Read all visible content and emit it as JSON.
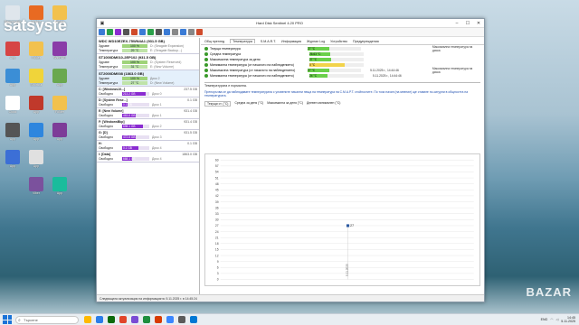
{
  "desktop": {
    "watermark": "satsyste",
    "brand": "BAZAR",
    "icons": [
      {
        "label": "Recycle Bin",
        "color": "#dfe6ec"
      },
      {
        "label": "Firefox",
        "color": "#e86a22"
      },
      {
        "label": "Folder",
        "color": "#f2c14e"
      },
      {
        "label": "App",
        "color": "#d64545"
      },
      {
        "label": "Folder",
        "color": "#f2c14e"
      },
      {
        "label": "WinRAR",
        "color": "#8a3ca8"
      },
      {
        "label": "App",
        "color": "#3b8ed6"
      },
      {
        "label": "Shortcut",
        "color": "#f0d43a"
      },
      {
        "label": "App",
        "color": "#6aa84f"
      },
      {
        "label": "Clock",
        "color": "#ffffff"
      },
      {
        "label": "App",
        "color": "#c0392b"
      },
      {
        "label": "Folder",
        "color": "#f2c14e"
      },
      {
        "label": "App",
        "color": "#555555"
      },
      {
        "label": "App",
        "color": "#2e86de"
      },
      {
        "label": "App",
        "color": "#7d3c98"
      },
      {
        "label": "App",
        "color": "#3c6fd6"
      },
      {
        "label": "App",
        "color": "#e0e0e0"
      },
      {
        "label": "Viber",
        "color": "#7b519d"
      },
      {
        "label": "App",
        "color": "#1abc9c"
      }
    ]
  },
  "window": {
    "title": "Hard Disk Sentinel 4.20 PRO",
    "disks": [
      {
        "name": "WDC WD10EZEX-75WN4A1 (931.5 GB)",
        "health": "100 %",
        "temp": "29 °C",
        "selected": false,
        "health_note": "D: (Seagate Expansion)",
        "temp_note": "E: (Seagate Backup...)"
      },
      {
        "name": "ST1000DM010-2EP102 (931.5 GB)",
        "health": "100 %",
        "temp": "31 °C",
        "selected": false,
        "health_note": "D: (System Reserved)",
        "temp_note": "E: (New Volume)"
      },
      {
        "name": "ST2000DM008 (1863.0 GB)",
        "health": "100 %",
        "temp": "27 °C",
        "selected": true,
        "health_note": "Диск 2",
        "temp_note": "D: (New Volume)"
      }
    ],
    "labels": {
      "health": "Здраве",
      "temp": "Температура",
      "free": "Свободно"
    },
    "partitions": [
      {
        "name": "C: [Windows10...]",
        "size": "237.5 GB",
        "free": "213.2 GB",
        "pct": 0.88,
        "disk": "Диск 0"
      },
      {
        "name": "D: [System Rese...]",
        "size": "0.1 GB",
        "free": "0.1 GB",
        "pct": 0.2,
        "disk": "Диск 1"
      },
      {
        "name": "E: [New Volume]",
        "size": "931.4 GB",
        "free": "463.8 GB",
        "pct": 0.5,
        "disk": "Диск 1"
      },
      {
        "name": "F: [WindowsBkp]",
        "size": "931.4 GB",
        "free": "698.1 GB",
        "pct": 0.75,
        "disk": "Диск 2"
      },
      {
        "name": "G: [D]",
        "size": "931.5 GB",
        "free": "472.8 GB",
        "pct": 0.51,
        "disk": "Диск 3"
      },
      {
        "name": "H:",
        "size": "0.1 GB",
        "free": "0.1 GB",
        "pct": 0.6,
        "disk": "Диск 4"
      },
      {
        "name": "I: [Data]",
        "size": "1863.0 GB",
        "free": "668.1 GB",
        "pct": 0.36,
        "disk": "Диск 4"
      }
    ],
    "tabs": [
      "Общ преглед",
      "Температура",
      "S.M.A.R.T.",
      "Информация",
      "Журнал Log",
      "Устройство",
      "Предупреждения"
    ],
    "active_tab": "Температура",
    "temp_rows": [
      {
        "label": "Текуща температура",
        "value": "27 °C",
        "pct": 0.4,
        "color": "#6ad04a",
        "ts": "",
        "desc": "Максимална температура на диска"
      },
      {
        "label": "Средна температура",
        "value": "26.63 °C",
        "pct": 0.38,
        "color": "#6ad04a",
        "ts": "",
        "desc": ""
      },
      {
        "label": "Максимална температура за деня",
        "value": "27 °C",
        "pct": 0.4,
        "color": "#6ad04a",
        "ts": "",
        "desc": ""
      },
      {
        "label": "Минимална температура (от началото на наблюдението)",
        "value": "0 °C",
        "pct": 0.65,
        "color": "#f2d34a",
        "ts": "",
        "desc": ""
      },
      {
        "label": "Максимална температура (от началото на наблюдението)",
        "value": "27 °C",
        "pct": 0.4,
        "color": "#6ad04a",
        "ts": "5.11.2025 г., 14:44:46",
        "desc": "Максимална температура на диска"
      },
      {
        "label": "Минимална температура (от началото на наблюдението)",
        "value": "24 °C",
        "pct": 0.34,
        "color": "#6ad04a",
        "ts": "5.11.2025 г., 14:44:46",
        "desc": ""
      }
    ],
    "section_title": "Температурата е нормална.",
    "info_text": "Препоръчва се да наблюдавате температурата с уловените начални неща на температура на С.М.А.Р.Т. стойностите. По този начин (на мнение) ще ставате по-сигурни в общността на температурата.",
    "subtabs": [
      "Текущи ст. (°C)",
      "Средна за деня (°C)",
      "Максимална за деня (°C)",
      "Дневен минимален (°C)"
    ],
    "chart_data": {
      "type": "line",
      "y_ticks": [
        "60",
        "57",
        "54",
        "51",
        "48",
        "45",
        "42",
        "39",
        "36",
        "33",
        "30",
        "27",
        "24",
        "21",
        "18",
        "15",
        "12",
        "9",
        "6",
        "3",
        "0"
      ],
      "ylim": [
        0,
        60
      ],
      "points": [
        {
          "x": "5.11.2025",
          "y": 27
        }
      ],
      "point_label": "27",
      "x_label": "5.11.2025"
    },
    "status": "Следващата актуализация на информацията: 5.11.2025 г. в 14:45:24"
  },
  "taskbar": {
    "search_placeholder": "Търсене",
    "apps": [
      "#ffb900",
      "#2b7de9",
      "#0b6a0b",
      "#e1452a",
      "#7a4bd4",
      "#1e8e3e",
      "#d83b01",
      "#3a86ff",
      "#5b5b5b",
      "#0078d4"
    ],
    "lang": "ENG",
    "time": "14:45",
    "date": "5.11.2025"
  }
}
